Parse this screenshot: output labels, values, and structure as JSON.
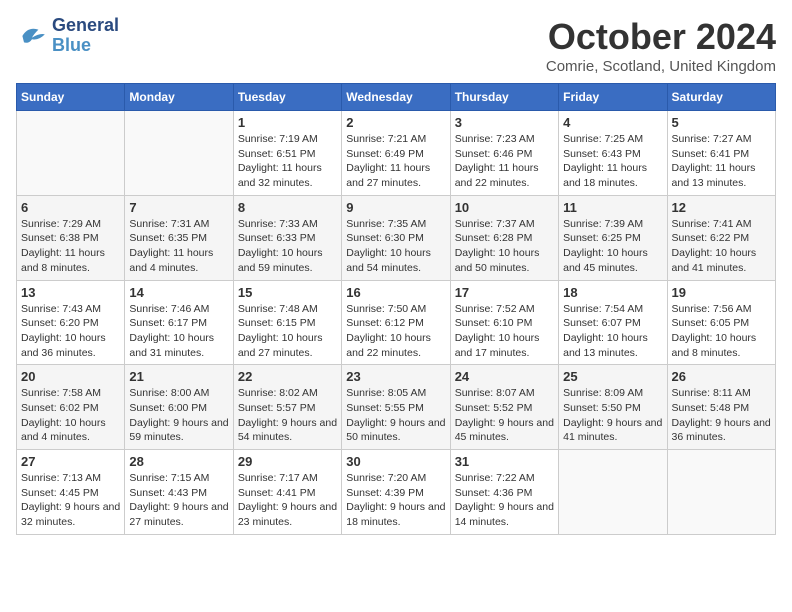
{
  "logo": {
    "line1": "General",
    "line2": "Blue"
  },
  "title": "October 2024",
  "subtitle": "Comrie, Scotland, United Kingdom",
  "days_header": [
    "Sunday",
    "Monday",
    "Tuesday",
    "Wednesday",
    "Thursday",
    "Friday",
    "Saturday"
  ],
  "weeks": [
    [
      {
        "day": "",
        "info": ""
      },
      {
        "day": "",
        "info": ""
      },
      {
        "day": "1",
        "info": "Sunrise: 7:19 AM\nSunset: 6:51 PM\nDaylight: 11 hours and 32 minutes."
      },
      {
        "day": "2",
        "info": "Sunrise: 7:21 AM\nSunset: 6:49 PM\nDaylight: 11 hours and 27 minutes."
      },
      {
        "day": "3",
        "info": "Sunrise: 7:23 AM\nSunset: 6:46 PM\nDaylight: 11 hours and 22 minutes."
      },
      {
        "day": "4",
        "info": "Sunrise: 7:25 AM\nSunset: 6:43 PM\nDaylight: 11 hours and 18 minutes."
      },
      {
        "day": "5",
        "info": "Sunrise: 7:27 AM\nSunset: 6:41 PM\nDaylight: 11 hours and 13 minutes."
      }
    ],
    [
      {
        "day": "6",
        "info": "Sunrise: 7:29 AM\nSunset: 6:38 PM\nDaylight: 11 hours and 8 minutes."
      },
      {
        "day": "7",
        "info": "Sunrise: 7:31 AM\nSunset: 6:35 PM\nDaylight: 11 hours and 4 minutes."
      },
      {
        "day": "8",
        "info": "Sunrise: 7:33 AM\nSunset: 6:33 PM\nDaylight: 10 hours and 59 minutes."
      },
      {
        "day": "9",
        "info": "Sunrise: 7:35 AM\nSunset: 6:30 PM\nDaylight: 10 hours and 54 minutes."
      },
      {
        "day": "10",
        "info": "Sunrise: 7:37 AM\nSunset: 6:28 PM\nDaylight: 10 hours and 50 minutes."
      },
      {
        "day": "11",
        "info": "Sunrise: 7:39 AM\nSunset: 6:25 PM\nDaylight: 10 hours and 45 minutes."
      },
      {
        "day": "12",
        "info": "Sunrise: 7:41 AM\nSunset: 6:22 PM\nDaylight: 10 hours and 41 minutes."
      }
    ],
    [
      {
        "day": "13",
        "info": "Sunrise: 7:43 AM\nSunset: 6:20 PM\nDaylight: 10 hours and 36 minutes."
      },
      {
        "day": "14",
        "info": "Sunrise: 7:46 AM\nSunset: 6:17 PM\nDaylight: 10 hours and 31 minutes."
      },
      {
        "day": "15",
        "info": "Sunrise: 7:48 AM\nSunset: 6:15 PM\nDaylight: 10 hours and 27 minutes."
      },
      {
        "day": "16",
        "info": "Sunrise: 7:50 AM\nSunset: 6:12 PM\nDaylight: 10 hours and 22 minutes."
      },
      {
        "day": "17",
        "info": "Sunrise: 7:52 AM\nSunset: 6:10 PM\nDaylight: 10 hours and 17 minutes."
      },
      {
        "day": "18",
        "info": "Sunrise: 7:54 AM\nSunset: 6:07 PM\nDaylight: 10 hours and 13 minutes."
      },
      {
        "day": "19",
        "info": "Sunrise: 7:56 AM\nSunset: 6:05 PM\nDaylight: 10 hours and 8 minutes."
      }
    ],
    [
      {
        "day": "20",
        "info": "Sunrise: 7:58 AM\nSunset: 6:02 PM\nDaylight: 10 hours and 4 minutes."
      },
      {
        "day": "21",
        "info": "Sunrise: 8:00 AM\nSunset: 6:00 PM\nDaylight: 9 hours and 59 minutes."
      },
      {
        "day": "22",
        "info": "Sunrise: 8:02 AM\nSunset: 5:57 PM\nDaylight: 9 hours and 54 minutes."
      },
      {
        "day": "23",
        "info": "Sunrise: 8:05 AM\nSunset: 5:55 PM\nDaylight: 9 hours and 50 minutes."
      },
      {
        "day": "24",
        "info": "Sunrise: 8:07 AM\nSunset: 5:52 PM\nDaylight: 9 hours and 45 minutes."
      },
      {
        "day": "25",
        "info": "Sunrise: 8:09 AM\nSunset: 5:50 PM\nDaylight: 9 hours and 41 minutes."
      },
      {
        "day": "26",
        "info": "Sunrise: 8:11 AM\nSunset: 5:48 PM\nDaylight: 9 hours and 36 minutes."
      }
    ],
    [
      {
        "day": "27",
        "info": "Sunrise: 7:13 AM\nSunset: 4:45 PM\nDaylight: 9 hours and 32 minutes."
      },
      {
        "day": "28",
        "info": "Sunrise: 7:15 AM\nSunset: 4:43 PM\nDaylight: 9 hours and 27 minutes."
      },
      {
        "day": "29",
        "info": "Sunrise: 7:17 AM\nSunset: 4:41 PM\nDaylight: 9 hours and 23 minutes."
      },
      {
        "day": "30",
        "info": "Sunrise: 7:20 AM\nSunset: 4:39 PM\nDaylight: 9 hours and 18 minutes."
      },
      {
        "day": "31",
        "info": "Sunrise: 7:22 AM\nSunset: 4:36 PM\nDaylight: 9 hours and 14 minutes."
      },
      {
        "day": "",
        "info": ""
      },
      {
        "day": "",
        "info": ""
      }
    ]
  ]
}
